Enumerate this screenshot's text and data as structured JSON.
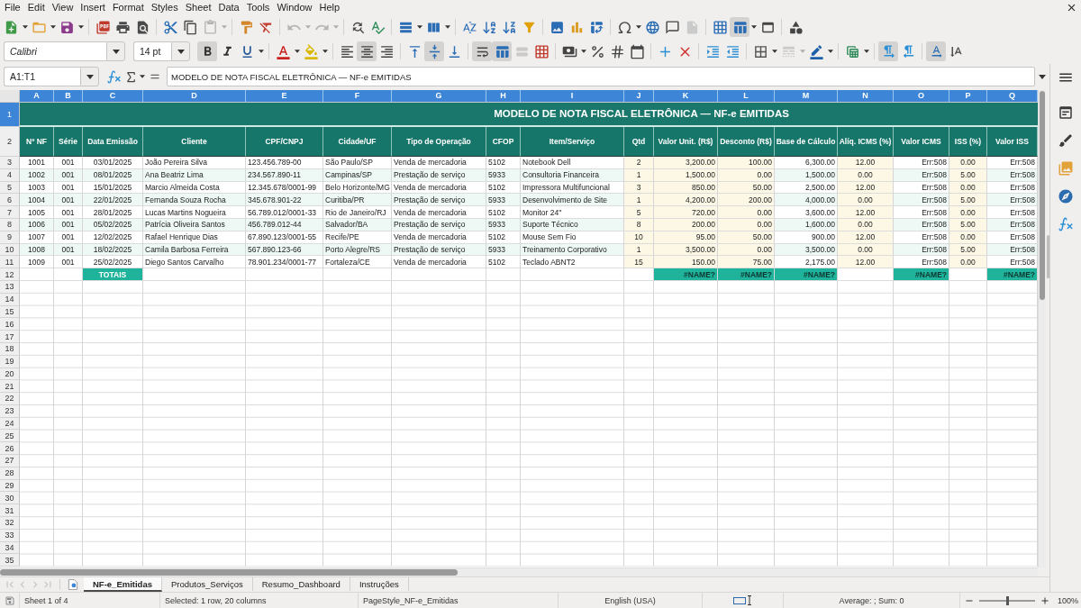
{
  "menu_bar": {
    "items": [
      "File",
      "Edit",
      "View",
      "Insert",
      "Format",
      "Styles",
      "Sheet",
      "Data",
      "Tools",
      "Window",
      "Help"
    ]
  },
  "standard_toolbar": [
    {
      "disabled": false,
      "pressed": false
    },
    {
      "disabled": false,
      "pressed": false
    },
    {
      "disabled": false,
      "pressed": false
    },
    {
      "disabled": false,
      "pressed": false
    },
    {
      "disabled": false,
      "pressed": false
    },
    {
      "disabled": false,
      "pressed": false
    },
    {
      "disabled": false,
      "pressed": false
    },
    {
      "disabled": false,
      "pressed": false
    },
    {
      "disabled": true,
      "pressed": false
    },
    {
      "disabled": false,
      "pressed": false
    },
    {
      "disabled": false,
      "pressed": false
    },
    {
      "disabled": true,
      "pressed": false
    },
    {
      "disabled": true,
      "pressed": false
    },
    {
      "disabled": false,
      "pressed": false
    },
    {
      "disabled": false,
      "pressed": false
    },
    {
      "disabled": false,
      "pressed": false
    },
    {
      "disabled": false,
      "pressed": false
    },
    {
      "disabled": false,
      "pressed": false
    },
    {
      "disabled": false,
      "pressed": false
    },
    {
      "disabled": false,
      "pressed": false
    },
    {
      "disabled": false,
      "pressed": false
    },
    {
      "disabled": false,
      "pressed": false
    },
    {
      "disabled": false,
      "pressed": false
    },
    {
      "disabled": false,
      "pressed": false
    },
    {
      "disabled": false,
      "pressed": false
    },
    {
      "disabled": false,
      "pressed": false
    },
    {
      "disabled": false,
      "pressed": false
    },
    {
      "disabled": true,
      "pressed": false
    },
    {
      "disabled": false,
      "pressed": false
    },
    {
      "disabled": false,
      "pressed": true
    },
    {
      "disabled": false,
      "pressed": false
    },
    {
      "disabled": false,
      "pressed": false
    }
  ],
  "formatting_toolbar": {
    "font_name": "Calibri",
    "font_size": "14 pt",
    "buttons": [
      {
        "disabled": false,
        "pressed": true
      },
      {
        "disabled": false,
        "pressed": false
      },
      {
        "disabled": false,
        "pressed": false
      },
      {
        "disabled": false,
        "pressed": false
      },
      {
        "disabled": false,
        "pressed": false
      },
      {
        "disabled": false,
        "pressed": false
      },
      {
        "disabled": false,
        "pressed": true
      },
      {
        "disabled": false,
        "pressed": false
      },
      {
        "disabled": false,
        "pressed": false
      },
      {
        "disabled": false,
        "pressed": true
      },
      {
        "disabled": false,
        "pressed": false
      },
      {
        "disabled": false,
        "pressed": true
      },
      {
        "disabled": false,
        "pressed": true
      },
      {
        "disabled": true,
        "pressed": false
      },
      {
        "disabled": false,
        "pressed": false
      },
      {
        "disabled": false,
        "pressed": false
      },
      {
        "disabled": false,
        "pressed": false
      },
      {
        "disabled": false,
        "pressed": false
      },
      {
        "disabled": false,
        "pressed": false
      },
      {
        "disabled": false,
        "pressed": false
      },
      {
        "disabled": false,
        "pressed": false
      },
      {
        "disabled": false,
        "pressed": false
      },
      {
        "disabled": false,
        "pressed": false
      },
      {
        "disabled": false,
        "pressed": false
      },
      {
        "disabled": true,
        "pressed": false
      },
      {
        "disabled": false,
        "pressed": false
      },
      {
        "disabled": false,
        "pressed": false
      },
      {
        "disabled": false,
        "pressed": true
      },
      {
        "disabled": false,
        "pressed": false
      },
      {
        "disabled": false,
        "pressed": true
      },
      {
        "disabled": false,
        "pressed": false
      }
    ]
  },
  "formula_bar": {
    "name_box": "A1:T1",
    "formula": "MODELO DE NOTA FISCAL ELETRÔNICA — NF-e EMITIDAS"
  },
  "sheet": {
    "title": "MODELO DE NOTA FISCAL ELETRÔNICA — NF-e EMITIDAS",
    "columns": [
      {
        "letter": "A",
        "selected": true,
        "header": "Nº NF",
        "kind": "data"
      },
      {
        "letter": "B",
        "selected": true,
        "header": "Série",
        "kind": "data"
      },
      {
        "letter": "C",
        "selected": true,
        "header": "Data Emissão",
        "kind": "data"
      },
      {
        "letter": "D",
        "selected": true,
        "header": "Cliente",
        "kind": "data"
      },
      {
        "letter": "E",
        "selected": true,
        "header": "CPF/CNPJ",
        "kind": "data"
      },
      {
        "letter": "F",
        "selected": true,
        "header": "Cidade/UF",
        "kind": "data"
      },
      {
        "letter": "G",
        "selected": true,
        "header": "Tipo de Operação",
        "kind": "data"
      },
      {
        "letter": "H",
        "selected": true,
        "header": "CFOP",
        "kind": "data"
      },
      {
        "letter": "I",
        "selected": true,
        "header": "Item/Serviço",
        "kind": "data"
      },
      {
        "letter": "J",
        "selected": true,
        "header": "Qtd",
        "kind": "input"
      },
      {
        "letter": "K",
        "selected": true,
        "header": "Valor Unit. (R$)",
        "kind": "input"
      },
      {
        "letter": "L",
        "selected": true,
        "header": "Desconto (R$)",
        "kind": "input"
      },
      {
        "letter": "M",
        "selected": true,
        "header": "Base de Cálculo",
        "kind": "data"
      },
      {
        "letter": "N",
        "selected": true,
        "header": "Alíq. ICMS (%)",
        "kind": "input"
      },
      {
        "letter": "O",
        "selected": true,
        "header": "Valor ICMS",
        "kind": "data"
      },
      {
        "letter": "P",
        "selected": true,
        "header": "ISS (%)",
        "kind": "input"
      },
      {
        "letter": "Q",
        "selected": true,
        "header": "Valor ISS",
        "kind": "data"
      }
    ],
    "row_numbers": [
      {
        "label": "1",
        "selected": true
      },
      {
        "label": "2",
        "selected": false
      },
      {
        "label": "3",
        "selected": false
      },
      {
        "label": "4",
        "selected": false
      },
      {
        "label": "5",
        "selected": false
      },
      {
        "label": "6",
        "selected": false
      },
      {
        "label": "7",
        "selected": false
      },
      {
        "label": "8",
        "selected": false
      },
      {
        "label": "9",
        "selected": false
      },
      {
        "label": "10",
        "selected": false
      },
      {
        "label": "11",
        "selected": false
      },
      {
        "label": "12",
        "selected": false
      },
      {
        "label": "13",
        "selected": false
      },
      {
        "label": "14",
        "selected": false
      },
      {
        "label": "15",
        "selected": false
      },
      {
        "label": "16",
        "selected": false
      },
      {
        "label": "17",
        "selected": false
      },
      {
        "label": "18",
        "selected": false
      },
      {
        "label": "19",
        "selected": false
      },
      {
        "label": "20",
        "selected": false
      },
      {
        "label": "21",
        "selected": false
      },
      {
        "label": "22",
        "selected": false
      },
      {
        "label": "23",
        "selected": false
      },
      {
        "label": "24",
        "selected": false
      },
      {
        "label": "25",
        "selected": false
      },
      {
        "label": "26",
        "selected": false
      },
      {
        "label": "27",
        "selected": false
      },
      {
        "label": "28",
        "selected": false
      },
      {
        "label": "29",
        "selected": false
      },
      {
        "label": "30",
        "selected": false
      },
      {
        "label": "31",
        "selected": false
      },
      {
        "label": "32",
        "selected": false
      },
      {
        "label": "33",
        "selected": false
      },
      {
        "label": "34",
        "selected": false
      },
      {
        "label": "35",
        "selected": false
      }
    ],
    "rows": [
      [
        "1001",
        "001",
        "03/01/2025",
        "João Pereira Silva",
        "123.456.789-00",
        "São Paulo/SP",
        "Venda de mercadoria",
        "5102",
        "Notebook Dell",
        "2",
        "3,200.00",
        "100.00",
        "6,300.00",
        "12.00",
        "Err:508",
        "0.00",
        "Err:508"
      ],
      [
        "1002",
        "001",
        "08/01/2025",
        "Ana Beatriz Lima",
        "234.567.890-11",
        "Campinas/SP",
        "Prestação de serviço",
        "5933",
        "Consultoria Financeira",
        "1",
        "1,500.00",
        "0.00",
        "1,500.00",
        "0.00",
        "Err:508",
        "5.00",
        "Err:508"
      ],
      [
        "1003",
        "001",
        "15/01/2025",
        "Marcio Almeida Costa",
        "12.345.678/0001-99",
        "Belo Horizonte/MG",
        "Venda de mercadoria",
        "5102",
        "Impressora Multifuncional",
        "3",
        "850.00",
        "50.00",
        "2,500.00",
        "12.00",
        "Err:508",
        "0.00",
        "Err:508"
      ],
      [
        "1004",
        "001",
        "22/01/2025",
        "Fernanda Souza Rocha",
        "345.678.901-22",
        "Curitiba/PR",
        "Prestação de serviço",
        "5933",
        "Desenvolvimento de Site",
        "1",
        "4,200.00",
        "200.00",
        "4,000.00",
        "0.00",
        "Err:508",
        "5.00",
        "Err:508"
      ],
      [
        "1005",
        "001",
        "28/01/2025",
        "Lucas Martins Nogueira",
        "56.789.012/0001-33",
        "Rio de Janeiro/RJ",
        "Venda de mercadoria",
        "5102",
        "Monitor 24\"",
        "5",
        "720.00",
        "0.00",
        "3,600.00",
        "12.00",
        "Err:508",
        "0.00",
        "Err:508"
      ],
      [
        "1006",
        "001",
        "05/02/2025",
        "Patrícia Oliveira Santos",
        "456.789.012-44",
        "Salvador/BA",
        "Prestação de serviço",
        "5933",
        "Suporte Técnico",
        "8",
        "200.00",
        "0.00",
        "1,600.00",
        "0.00",
        "Err:508",
        "5.00",
        "Err:508"
      ],
      [
        "1007",
        "001",
        "12/02/2025",
        "Rafael Henrique Dias",
        "67.890.123/0001-55",
        "Recife/PE",
        "Venda de mercadoria",
        "5102",
        "Mouse Sem Fio",
        "10",
        "95.00",
        "50.00",
        "900.00",
        "12.00",
        "Err:508",
        "0.00",
        "Err:508"
      ],
      [
        "1008",
        "001",
        "18/02/2025",
        "Camila Barbosa Ferreira",
        "567.890.123-66",
        "Porto Alegre/RS",
        "Prestação de serviço",
        "5933",
        "Treinamento Corporativo",
        "1",
        "3,500.00",
        "0.00",
        "3,500.00",
        "0.00",
        "Err:508",
        "5.00",
        "Err:508"
      ],
      [
        "1009",
        "001",
        "25/02/2025",
        "Diego Santos Carvalho",
        "78.901.234/0001-77",
        "Fortaleza/CE",
        "Venda de mercadoria",
        "5102",
        "Teclado ABNT2",
        "15",
        "150.00",
        "75.00",
        "2,175.00",
        "12.00",
        "Err:508",
        "0.00",
        "Err:508"
      ]
    ],
    "totals_row": [
      {
        "kind": "blank"
      },
      {
        "kind": "blank"
      },
      {
        "kind": "label",
        "text": "TOTAIS"
      },
      {
        "kind": "blank"
      },
      {
        "kind": "blank"
      },
      {
        "kind": "blank"
      },
      {
        "kind": "blank"
      },
      {
        "kind": "blank"
      },
      {
        "kind": "blank"
      },
      {
        "kind": "blank"
      },
      {
        "kind": "total",
        "text": "#NAME?"
      },
      {
        "kind": "total",
        "text": "#NAME?"
      },
      {
        "kind": "total",
        "text": "#NAME?"
      },
      {
        "kind": "blank"
      },
      {
        "kind": "total",
        "text": "#NAME?"
      },
      {
        "kind": "blank"
      },
      {
        "kind": "total",
        "text": "#NAME?"
      }
    ]
  },
  "sheet_tabs": [
    {
      "label": "NF-e_Emitidas",
      "selected": true
    },
    {
      "label": "Produtos_Serviços",
      "selected": false
    },
    {
      "label": "Resumo_Dashboard",
      "selected": false
    },
    {
      "label": "Instruções",
      "selected": false
    }
  ],
  "status_bar": {
    "sheet": "Sheet 1 of 4",
    "selection": "Selected: 1 row, 20 columns",
    "page_style": "PageStyle_NF-e_Emitidas",
    "language": "English (USA)",
    "statistics": "Average: ; Sum: 0",
    "zoom_slider": {
      "level": 0.5
    },
    "zoom": "100%"
  }
}
